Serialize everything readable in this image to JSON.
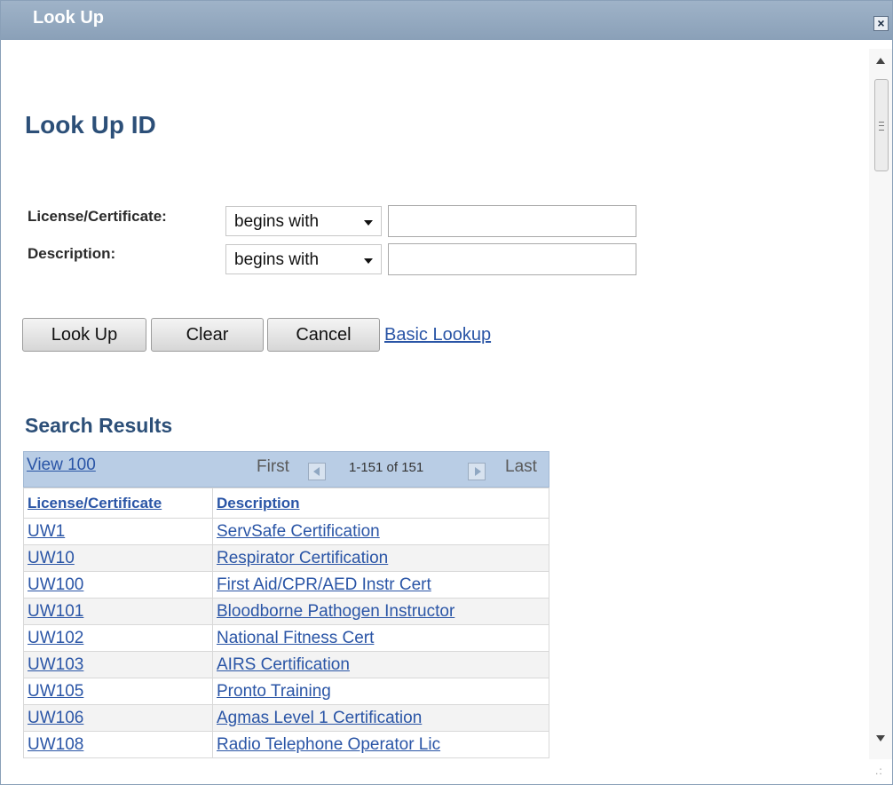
{
  "window": {
    "title": "Look Up",
    "close_glyph": "×"
  },
  "page": {
    "title": "Look Up ID"
  },
  "criteria": [
    {
      "label": "License/Certificate:",
      "operator": "begins with",
      "value": ""
    },
    {
      "label": "Description:",
      "operator": "begins with",
      "value": ""
    }
  ],
  "buttons": {
    "look_up": "Look Up",
    "clear": "Clear",
    "cancel": "Cancel",
    "basic_lookup": "Basic Lookup"
  },
  "results": {
    "title": "Search Results",
    "view_link": "View 100",
    "first": "First",
    "last": "Last",
    "count": "1-151 of 151",
    "columns": [
      "License/Certificate",
      "Description"
    ],
    "rows": [
      {
        "id": "UW1",
        "desc": "ServSafe Certification"
      },
      {
        "id": "UW10",
        "desc": "Respirator Certification"
      },
      {
        "id": "UW100",
        "desc": "First Aid/CPR/AED Instr Cert"
      },
      {
        "id": "UW101",
        "desc": "Bloodborne Pathogen Instructor"
      },
      {
        "id": "UW102",
        "desc": "National Fitness Cert"
      },
      {
        "id": "UW103",
        "desc": "AIRS Certification"
      },
      {
        "id": "UW105",
        "desc": "Pronto Training"
      },
      {
        "id": "UW106",
        "desc": "Agmas Level 1 Certification"
      },
      {
        "id": "UW108",
        "desc": "Radio Telephone Operator Lic"
      }
    ]
  },
  "icons": {
    "close": "close-icon",
    "scroll_up": "chevron-up-icon",
    "scroll_down": "chevron-down-icon",
    "prev": "prev-page-icon",
    "next": "next-page-icon",
    "dropdown": "caret-down-icon"
  },
  "colors": {
    "title_bar": "#8aa0b8",
    "heading": "#2c4f78",
    "link": "#2a55a6",
    "grid_header": "#b9cde5"
  }
}
